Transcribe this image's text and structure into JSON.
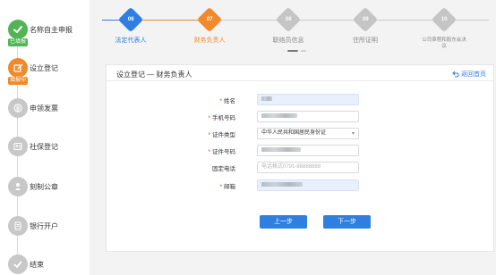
{
  "sidebar": {
    "items": [
      {
        "label": "名称自主申报",
        "badge": "已填报",
        "state": "done",
        "icon": "check-icon"
      },
      {
        "label": "设立登记",
        "badge": "填报中",
        "state": "active",
        "icon": "edit-icon"
      },
      {
        "label": "申领发票",
        "badge": "",
        "state": "pending",
        "icon": "invoice-icon"
      },
      {
        "label": "社保登记",
        "badge": "",
        "state": "pending",
        "icon": "social-security-icon"
      },
      {
        "label": "刻制公章",
        "badge": "",
        "state": "pending",
        "icon": "seal-icon"
      },
      {
        "label": "银行开户",
        "badge": "",
        "state": "pending",
        "icon": "bank-icon"
      },
      {
        "label": "结束",
        "badge": "",
        "state": "pending",
        "icon": "finish-icon"
      }
    ]
  },
  "stepper": {
    "steps": [
      {
        "num": "06",
        "label": "法定代表人",
        "state": "blue"
      },
      {
        "num": "07",
        "label": "财务负责人",
        "state": "orange"
      },
      {
        "num": "08",
        "label": "联络员信息",
        "state": "gray"
      },
      {
        "num": "09",
        "label": "住所证明",
        "state": "gray"
      },
      {
        "num": "10",
        "label": "公司章程和股东会决议",
        "state": "gray"
      }
    ]
  },
  "form": {
    "title": "设立登记 — 财务负责人",
    "back_label": "返回首页",
    "fields": [
      {
        "label": "姓名",
        "required": true,
        "value": "",
        "placeholder": "",
        "filled": true
      },
      {
        "label": "手机号码",
        "required": true,
        "value": "",
        "placeholder": "",
        "filled": false
      },
      {
        "label": "证件类型",
        "required": true,
        "value": "中华人民共和国居民身份证",
        "placeholder": "",
        "filled": false
      },
      {
        "label": "证件号码",
        "required": true,
        "value": "",
        "placeholder": "",
        "filled": false
      },
      {
        "label": "固定电话",
        "required": false,
        "value": "",
        "placeholder": "电话格式0791-88888888",
        "filled": false
      },
      {
        "label": "邮箱",
        "required": true,
        "value": "",
        "placeholder": "",
        "filled": true
      }
    ],
    "prev_label": "上一步",
    "next_label": "下一步"
  },
  "colors": {
    "done": "#52b455",
    "active": "#f08a2c",
    "primary": "#2f7fe0",
    "pending": "#c8c8c8"
  }
}
